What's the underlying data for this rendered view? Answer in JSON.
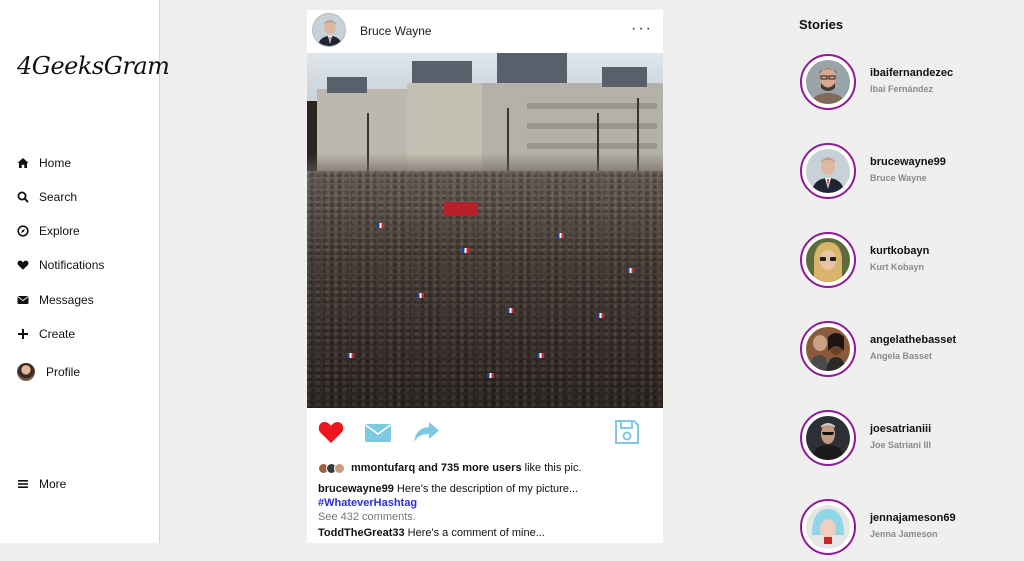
{
  "app": {
    "logo": "4GeeksGram"
  },
  "sidebar": {
    "items": [
      {
        "label": "Home",
        "icon": "home-icon"
      },
      {
        "label": "Search",
        "icon": "search-icon"
      },
      {
        "label": "Explore",
        "icon": "compass-icon"
      },
      {
        "label": "Notifications",
        "icon": "heart-icon"
      },
      {
        "label": "Messages",
        "icon": "envelope-icon"
      },
      {
        "label": "Create",
        "icon": "plus-icon"
      },
      {
        "label": "Profile",
        "icon": "avatar"
      }
    ],
    "more": {
      "label": "More",
      "icon": "menu-icon"
    }
  },
  "post": {
    "author": "Bruce Wayne",
    "more_icon": "ellipsis-icon",
    "image_alt": "crowd-photo",
    "actions": {
      "like": {
        "icon": "heart-icon",
        "color": "#f0141e",
        "liked": true
      },
      "message": {
        "icon": "envelope-icon",
        "color": "#7ec8e3"
      },
      "share": {
        "icon": "share-icon",
        "color": "#7ec8e3"
      },
      "save": {
        "icon": "save-icon",
        "color": "#7ec8e3"
      }
    },
    "likes": {
      "user": "mmontufarq",
      "others": "and 735 more users",
      "suffix": "like this pic."
    },
    "description": {
      "username": "brucewayne99",
      "text": "Here's the description of my picture...",
      "hashtag": "#WhateverHashtag"
    },
    "comments_link": "See 432 comments.",
    "comment": {
      "username": "ToddTheGreat33",
      "text": "Here's a comment of mine..."
    }
  },
  "stories": {
    "title": "Stories",
    "items": [
      {
        "username": "ibaifernandezec",
        "name": "Ibai Fernández"
      },
      {
        "username": "brucewayne99",
        "name": "Bruce Wayne"
      },
      {
        "username": "kurtkobayn",
        "name": "Kurt Kobayn"
      },
      {
        "username": "angelathebasset",
        "name": "Angela Basset"
      },
      {
        "username": "joesatrianiii",
        "name": "Joe Satriani III"
      },
      {
        "username": "jennajameson69",
        "name": "Jenna Jameson"
      }
    ],
    "ring_color": "#8e1b96"
  }
}
